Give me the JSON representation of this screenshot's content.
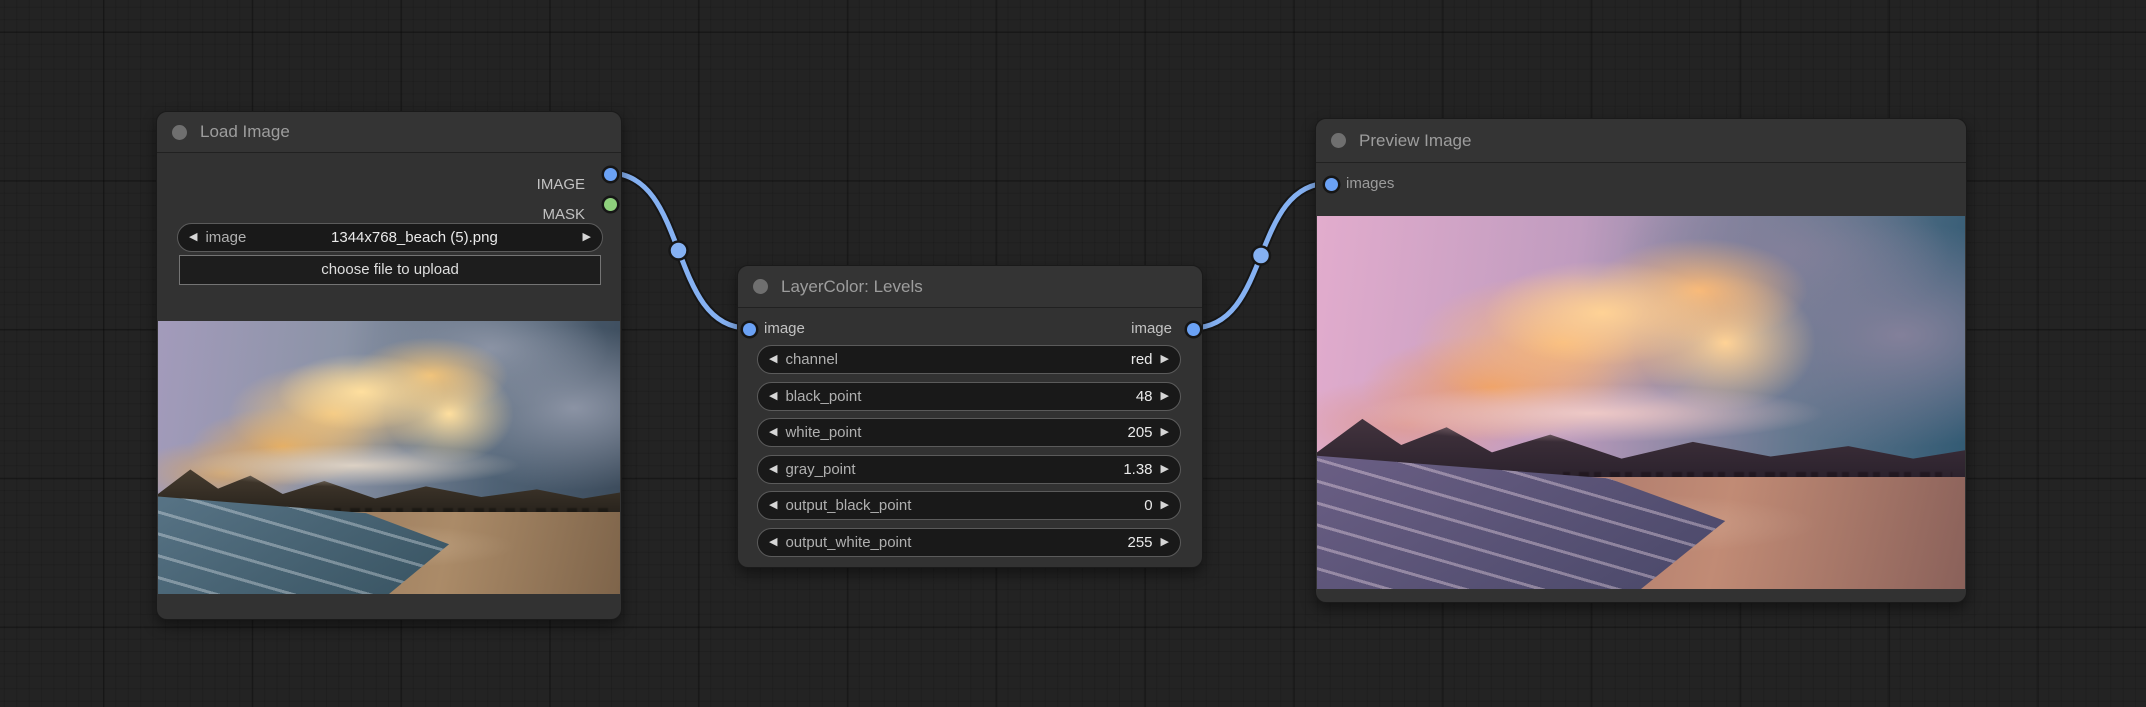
{
  "icons": {
    "arrow_left": "◀",
    "arrow_right": "▶"
  },
  "colors": {
    "canvas_bg": "#232323",
    "node_bg": "#323232",
    "link": "#85b1f2",
    "port_image": "#6ba2f5",
    "port_mask": "#8ed07c"
  },
  "nodes": {
    "load_image": {
      "title": "Load Image",
      "outputs": [
        {
          "label": "IMAGE"
        },
        {
          "label": "MASK"
        }
      ],
      "combo": {
        "label": "image",
        "value": "1344x768_beach (5).png"
      },
      "upload_button_label": "choose file to upload",
      "preview_alt": "Beach at sunset: golden clouds over dark mountains, surf at left, sand at right"
    },
    "levels": {
      "title": "LayerColor: Levels",
      "input_label": "image",
      "output_label": "image",
      "widgets": [
        {
          "label": "channel",
          "value": "red"
        },
        {
          "label": "black_point",
          "value": "48"
        },
        {
          "label": "white_point",
          "value": "205"
        },
        {
          "label": "gray_point",
          "value": "1.38"
        },
        {
          "label": "output_black_point",
          "value": "0"
        },
        {
          "label": "output_white_point",
          "value": "255"
        }
      ]
    },
    "preview_image": {
      "title": "Preview Image",
      "input_label": "images",
      "preview_alt": "Levels-adjusted beach photo with pink-magenta sky and purple surf"
    }
  }
}
